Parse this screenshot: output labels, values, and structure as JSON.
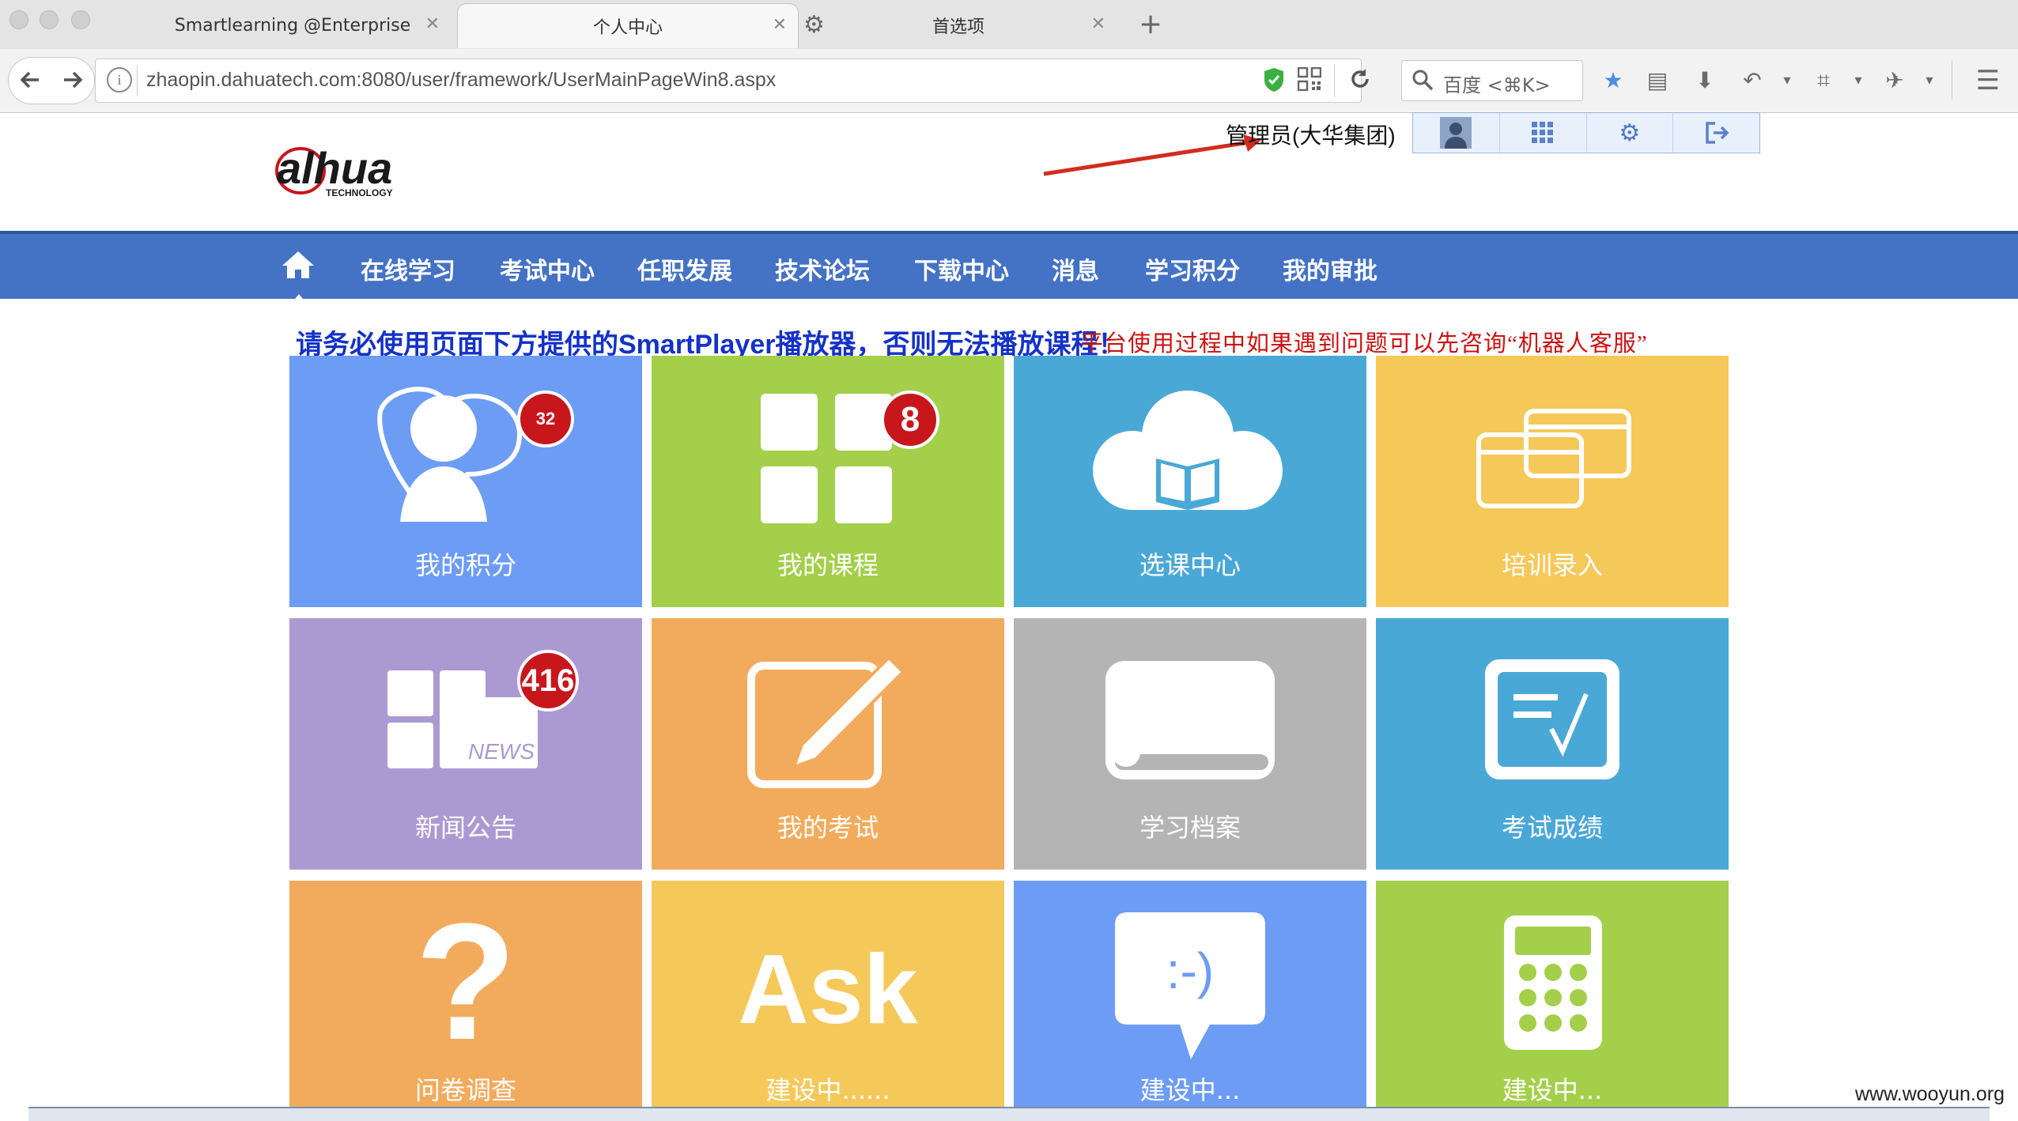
{
  "browser": {
    "tabs": [
      {
        "label": "Smartlearning @Enterprise"
      },
      {
        "label": "个人中心"
      },
      {
        "label": "首选项"
      }
    ],
    "url": "zhaopin.dahuatech.com:8080/user/framework/UserMainPageWin8.aspx",
    "search_placeholder": "百度 <⌘K>"
  },
  "header": {
    "logo_text": "alhua",
    "logo_sub": "TECHNOLOGY",
    "user_label": "管理员(大华集团)",
    "user_toolbar": [
      "user-icon",
      "apps-icon",
      "gear-icon",
      "logout-icon"
    ]
  },
  "nav": {
    "items": [
      "在线学习",
      "考试中心",
      "任职发展",
      "技术论坛",
      "下载中心",
      "消息",
      "学习积分",
      "我的审批"
    ]
  },
  "notice": {
    "blue": "请务必使用页面下方提供的SmartPlayer播放器，否则无法播放课程！",
    "red": "平台使用过程中如果遇到问题可以先咨询“机器人客服”"
  },
  "tiles": [
    {
      "label": "我的积分",
      "badge": "32",
      "color": "#6d9cf5",
      "icon": "chat-person-icon"
    },
    {
      "label": "我的课程",
      "badge": "8",
      "color": "#a4cf4a",
      "icon": "grid-icon"
    },
    {
      "label": "选课中心",
      "color": "#4aa8d6",
      "icon": "cloud-book-icon"
    },
    {
      "label": "培训录入",
      "color": "#f5c85a",
      "icon": "windows-icon"
    },
    {
      "label": "新闻公告",
      "badge": "416",
      "color": "#ab9ad2",
      "icon": "news-icon",
      "icon_text": "NEWS"
    },
    {
      "label": "我的考试",
      "color": "#f2ab5c",
      "icon": "edit-icon"
    },
    {
      "label": "学习档案",
      "color": "#b4b4b4",
      "icon": "folder-icon"
    },
    {
      "label": "考试成绩",
      "color": "#4aa8d6",
      "icon": "scorecard-icon"
    },
    {
      "label": "问卷调查",
      "color": "#f2ab5c",
      "icon": "question-icon",
      "icon_text": "?"
    },
    {
      "label": "建设中......",
      "color": "#f5c85a",
      "icon": "ask-icon",
      "icon_text": "Ask"
    },
    {
      "label": "建设中...",
      "color": "#6d9cf5",
      "icon": "smiley-bubble-icon",
      "icon_text": ":-)"
    },
    {
      "label": "建设中...",
      "color": "#a4cf4a",
      "icon": "calculator-icon"
    }
  ],
  "watermark": "www.wooyun.org"
}
